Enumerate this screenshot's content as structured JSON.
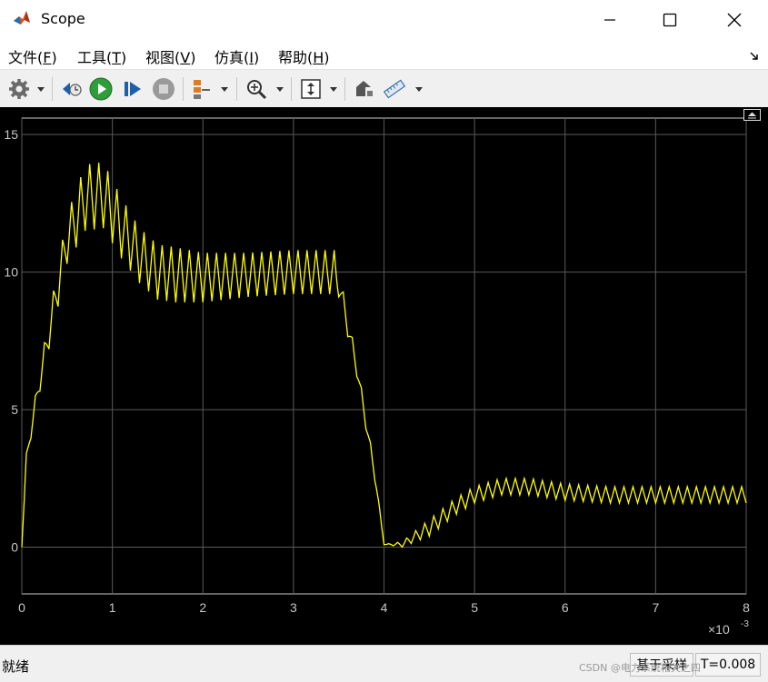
{
  "window": {
    "title": "Scope"
  },
  "menu": [
    {
      "label": "文件(",
      "key": "F",
      "tail": ")"
    },
    {
      "label": "工具(",
      "key": "T",
      "tail": ")"
    },
    {
      "label": "视图(",
      "key": "V",
      "tail": ")"
    },
    {
      "label": "仿真(",
      "key": "I",
      "tail": ")"
    },
    {
      "label": "帮助(",
      "key": "H",
      "tail": ")"
    }
  ],
  "toolbar": {
    "icons": [
      "settings-gear-icon",
      "dropdown-arrow-icon",
      "step-back-icon",
      "run-play-icon",
      "step-forward-icon",
      "stop-icon",
      "signal-triggers-icon",
      "dropdown-arrow-icon",
      "zoom-in-icon",
      "dropdown-arrow-icon",
      "scale-axes-icon",
      "dropdown-arrow-icon",
      "highlight-simulink-block-icon",
      "measurements-ruler-icon",
      "dropdown-arrow-icon"
    ]
  },
  "plot": {
    "line_color": "#ffff00",
    "background": "#000000",
    "grid_color": "#5a5a5a",
    "axis_color": "#c8c8c8",
    "exponent_base": "×10",
    "exponent_power": "-3"
  },
  "chart_data": {
    "type": "line",
    "xlim": [
      0,
      8
    ],
    "ylim": [
      -1.7,
      15.6
    ],
    "x_ticks": [
      "0",
      "1",
      "2",
      "3",
      "4",
      "5",
      "6",
      "7",
      "8"
    ],
    "y_ticks": [
      "0",
      "5",
      "10",
      "15"
    ],
    "x_tick_values": [
      0,
      1,
      2,
      3,
      4,
      5,
      6,
      7,
      8
    ],
    "y_tick_values": [
      0,
      5,
      10,
      15
    ],
    "grid": true,
    "series": [
      {
        "color": "#ffff00",
        "envelope_x": [
          0,
          0.05,
          0.15,
          0.3,
          0.5,
          0.7,
          0.9,
          1.1,
          1.3,
          1.5,
          1.7,
          2.0,
          2.5,
          3.0,
          3.45,
          3.5,
          3.7,
          3.9,
          4.0,
          4.2,
          4.5,
          4.8,
          5.0,
          5.3,
          5.6,
          6.0,
          6.5,
          7.0,
          7.5,
          8.0
        ],
        "envelope_y": [
          0,
          3.2,
          5.2,
          7.8,
          11.2,
          12.7,
          12.8,
          11.6,
          10.6,
          10.0,
          9.9,
          9.8,
          9.9,
          10.0,
          10.0,
          9.6,
          6.5,
          2.6,
          0.1,
          0.1,
          0.7,
          1.5,
          1.9,
          2.2,
          2.2,
          2.0,
          1.9,
          1.9,
          1.9,
          1.9
        ],
        "ripple_amplitude": [
          0,
          0.2,
          0.3,
          0.6,
          0.9,
          1.2,
          1.2,
          1.1,
          1.0,
          1.0,
          1.0,
          0.9,
          0.8,
          0.8,
          0.8,
          0.5,
          0.3,
          0.2,
          0.0,
          0.1,
          0.3,
          0.3,
          0.3,
          0.3,
          0.3,
          0.3,
          0.3,
          0.3,
          0.3,
          0.3
        ],
        "ripple_period": 0.1
      }
    ]
  },
  "status": {
    "left": "就绪",
    "mode": "基于采样",
    "time": "T=0.008"
  },
  "watermark": "CSDN @电力系统相关之四"
}
